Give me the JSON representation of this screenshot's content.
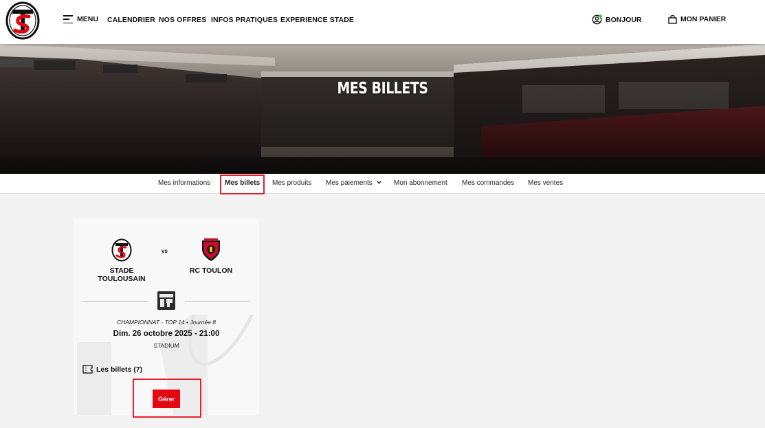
{
  "header": {
    "menu_label": "MENU",
    "nav": [
      "CALENDRIER",
      "NOS OFFRES",
      "INFOS PRATIQUES",
      "EXPERIENCE STADE"
    ],
    "greeting": "BONJOUR",
    "cart_label": "MON PANIER",
    "online_dot_color": "#2ecc40"
  },
  "hero": {
    "title": "MES BILLETS"
  },
  "tabs": [
    {
      "label": "Mes informations",
      "active": false
    },
    {
      "label": "Mes billets",
      "active": true
    },
    {
      "label": "Mes produits",
      "active": false
    },
    {
      "label": "Mes paiements",
      "active": false,
      "dropdown": true
    },
    {
      "label": "Mon abonnement",
      "active": false
    },
    {
      "label": "Mes commandes",
      "active": false
    },
    {
      "label": "Mes ventes",
      "active": false
    }
  ],
  "match": {
    "home_team": "STADE TOULOUSAIN",
    "vs": "vs",
    "away_team": "RC TOULON",
    "competition": "CHAMPIONNAT - TOP 14 • Journée 8",
    "date": "Dim. 26 octobre 2025 - 21:00",
    "venue": "STADIUM",
    "tickets_label": "Les billets (7)",
    "manage_label": "Gérer"
  },
  "colors": {
    "accent_red": "#e30613",
    "highlight_outline": "#e5202e"
  }
}
